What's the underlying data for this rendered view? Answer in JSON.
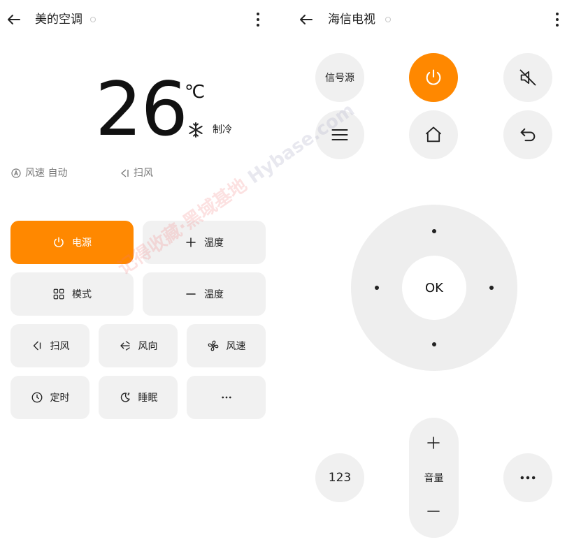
{
  "ac": {
    "title": "美的空调",
    "temperature": "26",
    "unit": "℃",
    "mode": "制冷",
    "fan_status": "风速 自动",
    "swing_status": "扫风",
    "buttons": {
      "power": "电源",
      "temp_up": "温度",
      "mode": "模式",
      "temp_down": "温度",
      "swing": "扫风",
      "direction": "风向",
      "fan_speed": "风速",
      "timer": "定时",
      "sleep": "睡眠"
    }
  },
  "tv": {
    "title": "海信电视",
    "source": "信号源",
    "ok": "OK",
    "numpad": "123",
    "volume": "音量"
  },
  "watermark": {
    "cn": "记得收藏·黑域基地",
    "en": "Hybase.com"
  },
  "colors": {
    "accent": "#ff8800",
    "button_bg": "#f1f1f1",
    "dpad_bg": "#eeeeee"
  }
}
